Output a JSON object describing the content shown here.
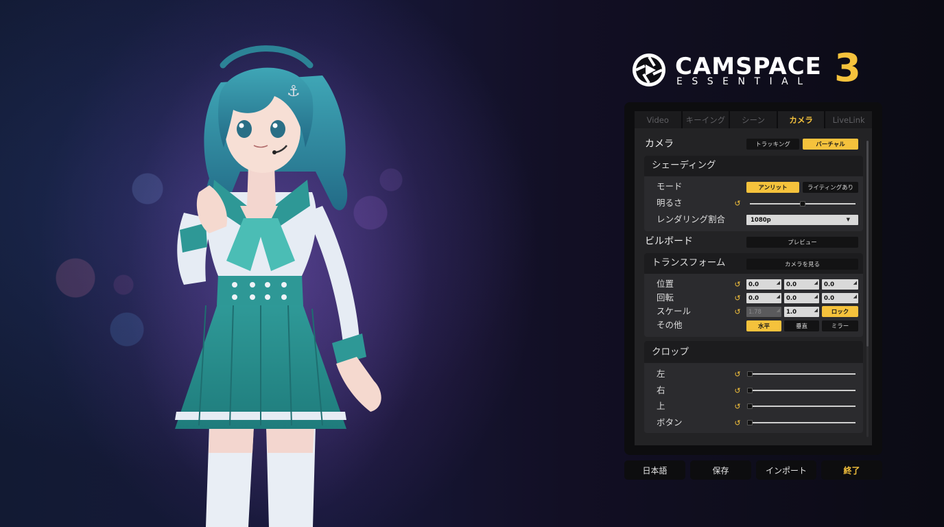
{
  "logo": {
    "title": "CAMSPACE",
    "subtitle": "ESSENTIAL",
    "version": "3",
    "icon": "camera-aperture-play-icon"
  },
  "colors": {
    "accent": "#f5c23c",
    "panel": "#0d0d0f",
    "panel_body": "#232325"
  },
  "tabs": [
    {
      "label": "Video",
      "active": false
    },
    {
      "label": "キーイング",
      "active": false
    },
    {
      "label": "シーン",
      "active": false
    },
    {
      "label": "カメラ",
      "active": true
    },
    {
      "label": "LiveLink",
      "active": false
    }
  ],
  "camera": {
    "title": "カメラ",
    "mode_buttons": [
      "トラッキング",
      "バーチャル"
    ],
    "mode_selected": "バーチャル"
  },
  "shading": {
    "title": "シェーディング",
    "mode_label": "モード",
    "mode_options": [
      "アンリット",
      "ライティングあり"
    ],
    "mode_selected": "アンリット",
    "brightness_label": "明るさ",
    "brightness_value": 0.5,
    "render_label": "レンダリング割合",
    "render_value": "1080p"
  },
  "billboard": {
    "title": "ビルボード",
    "preview_button": "プレビュー"
  },
  "transform": {
    "title": "トランスフォーム",
    "look_button": "カメラを見る",
    "position_label": "位置",
    "position": [
      "0.0",
      "0.0",
      "0.0"
    ],
    "rotation_label": "回転",
    "rotation": [
      "0.0",
      "0.0",
      "0.0"
    ],
    "scale_label": "スケール",
    "scale": [
      "1.78",
      "1.0"
    ],
    "lock_button": "ロック",
    "other_label": "その他",
    "other_buttons": [
      "水平",
      "垂直",
      "ミラー"
    ],
    "other_selected": "水平"
  },
  "crop": {
    "title": "クロップ",
    "rows": [
      {
        "label": "左",
        "value": 0
      },
      {
        "label": "右",
        "value": 0
      },
      {
        "label": "上",
        "value": 0
      },
      {
        "label": "ボタン",
        "value": 0
      }
    ]
  },
  "bottom": {
    "language": "日本語",
    "save": "保存",
    "import": "インポート",
    "exit": "終了"
  }
}
